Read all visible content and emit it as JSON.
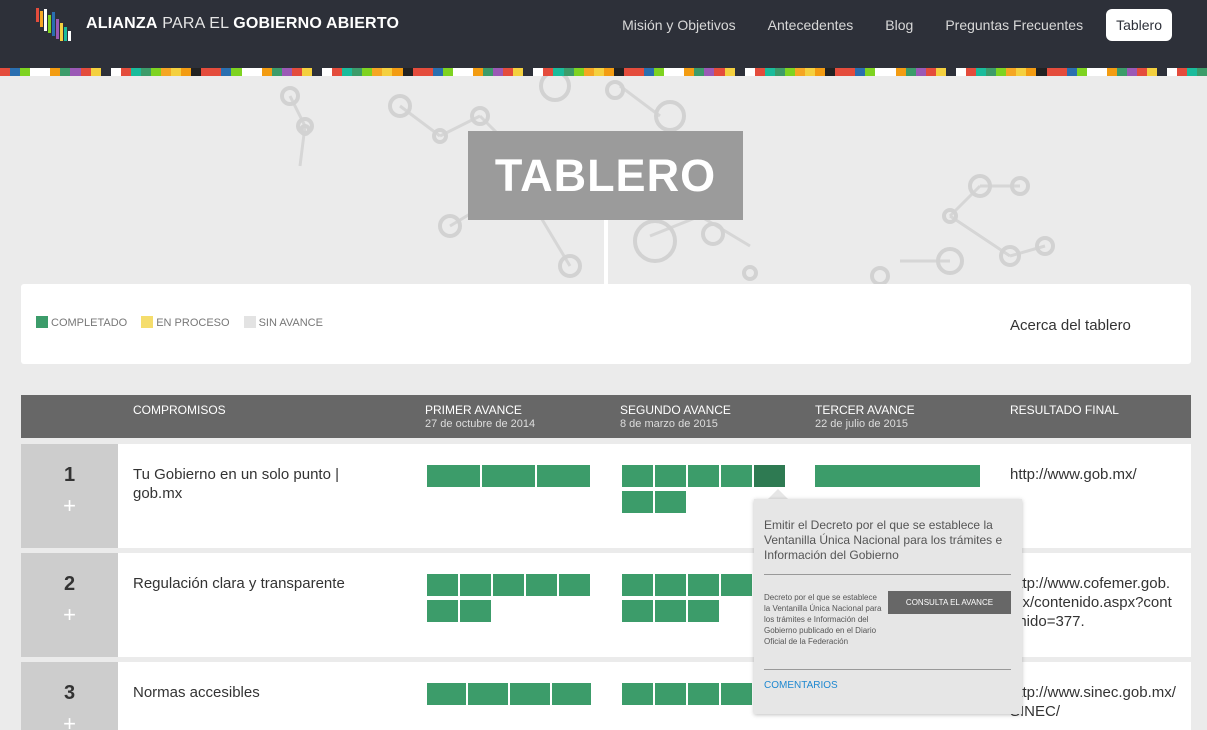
{
  "header": {
    "brand": {
      "part1": "ALIANZA",
      "part2": "PARA EL",
      "part3": "GOBIERNO ABIERTO"
    },
    "menu": [
      {
        "label": "Misión y Objetivos"
      },
      {
        "label": "Antecedentes"
      },
      {
        "label": "Blog"
      },
      {
        "label": "Preguntas Frecuentes"
      },
      {
        "label": "Tablero",
        "active": true
      }
    ]
  },
  "stripe_colors": [
    "#e44c3c",
    "#f5a623",
    "#ffffff",
    "#222222",
    "#3c9c6a",
    "#2a6fb0",
    "#f4d03f",
    "#ffffff",
    "#e44c3c",
    "#9b59b6",
    "#7ed321",
    "#2d3039",
    "#f39c12",
    "#1abc9c"
  ],
  "hero": {
    "title": "TABLERO"
  },
  "legend": {
    "items": [
      {
        "label": "COMPLETADO",
        "color": "#3c9c6a"
      },
      {
        "label": "EN PROCESO",
        "color": "#f5dd6c"
      },
      {
        "label": "SIN AVANCE",
        "color": "#e3e3e3"
      }
    ],
    "about_link": "Acerca del tablero"
  },
  "table": {
    "columns": {
      "compromisos": "COMPROMISOS",
      "primer": {
        "label": "PRIMER AVANCE",
        "date": "27 de octubre de 2014"
      },
      "segundo": {
        "label": "SEGUNDO AVANCE",
        "date": "8 de marzo de 2015"
      },
      "tercer": {
        "label": "TERCER AVANCE",
        "date": "22 de julio de 2015"
      },
      "resultado": "RESULTADO FINAL"
    },
    "rows": [
      {
        "number": "1",
        "expand": "+",
        "name": "Tu Gobierno en un solo punto | gob.mx",
        "primer_completed": 3,
        "segundo_completed": 7,
        "tercer_completed": 1,
        "url": "http://www.gob.mx/"
      },
      {
        "number": "2",
        "expand": "+",
        "name": "Regulación clara y transparente",
        "primer_completed": 7,
        "segundo_completed": 8,
        "url": "http://www.cofemer.gob.mx/contenido.aspx?contenido=377."
      },
      {
        "number": "3",
        "expand": "+",
        "name": "Normas accesibles",
        "primer_completed": 4,
        "segundo_completed": 5,
        "url": "http://www.sinec.gob.mx/SINEC/"
      }
    ]
  },
  "popover": {
    "title": "Emitir el Decreto por el que se establece la Ventanilla Única Nacional para los trámites e Información del Gobierno",
    "description": "Decreto por el que se establece la Ventanilla Única Nacional para los trámites e Información del Gobierno publicado en el Diario Oficial de la Federación",
    "button": "CONSULTA EL AVANCE",
    "comments_link": "COMENTARIOS"
  }
}
